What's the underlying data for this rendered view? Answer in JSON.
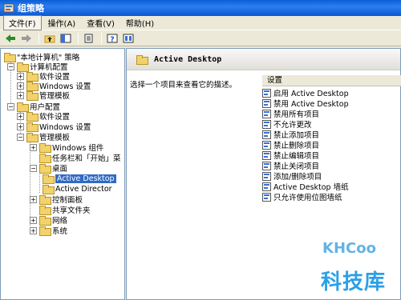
{
  "window": {
    "title": "组策略"
  },
  "menu": [
    {
      "label": "文件(F)"
    },
    {
      "label": "操作(A)"
    },
    {
      "label": "查看(V)"
    },
    {
      "label": "帮助(H)"
    }
  ],
  "toolbar": {
    "icons": [
      "back-icon",
      "forward-icon",
      "up-folder-icon",
      "show-hide-tree-icon",
      "export-list-icon",
      "help-icon",
      "properties-icon"
    ]
  },
  "tree": {
    "items": [
      {
        "label": "\"本地计算机\" 策略"
      },
      {
        "label": "计算机配置"
      },
      {
        "label": "软件设置"
      },
      {
        "label": "Windows 设置"
      },
      {
        "label": "管理模板"
      },
      {
        "label": "用户配置"
      },
      {
        "label": "软件设置"
      },
      {
        "label": "Windows 设置"
      },
      {
        "label": "管理模板"
      },
      {
        "label": "Windows 组件"
      },
      {
        "label": "任务栏和「开始」菜"
      },
      {
        "label": "桌面"
      },
      {
        "label": "Active Desktop"
      },
      {
        "label": "Active Director"
      },
      {
        "label": "控制面板"
      },
      {
        "label": "共享文件夹"
      },
      {
        "label": "网络"
      },
      {
        "label": "系统"
      }
    ]
  },
  "details": {
    "header_title": "Active Desktop",
    "description": "选择一个项目来查看它的描述。",
    "column_header": "设置",
    "settings": [
      {
        "label": "启用 Active Desktop"
      },
      {
        "label": "禁用 Active Desktop"
      },
      {
        "label": "禁用所有项目"
      },
      {
        "label": "不允许更改"
      },
      {
        "label": "禁止添加项目"
      },
      {
        "label": "禁止删除项目"
      },
      {
        "label": "禁止编辑项目"
      },
      {
        "label": "禁止关闭项目"
      },
      {
        "label": "添加/删除项目"
      },
      {
        "label": "Active Desktop 墙纸"
      },
      {
        "label": "只允许使用位图墙纸"
      }
    ]
  },
  "watermark": {
    "top": "KHCoo",
    "bottom": "科技库"
  }
}
